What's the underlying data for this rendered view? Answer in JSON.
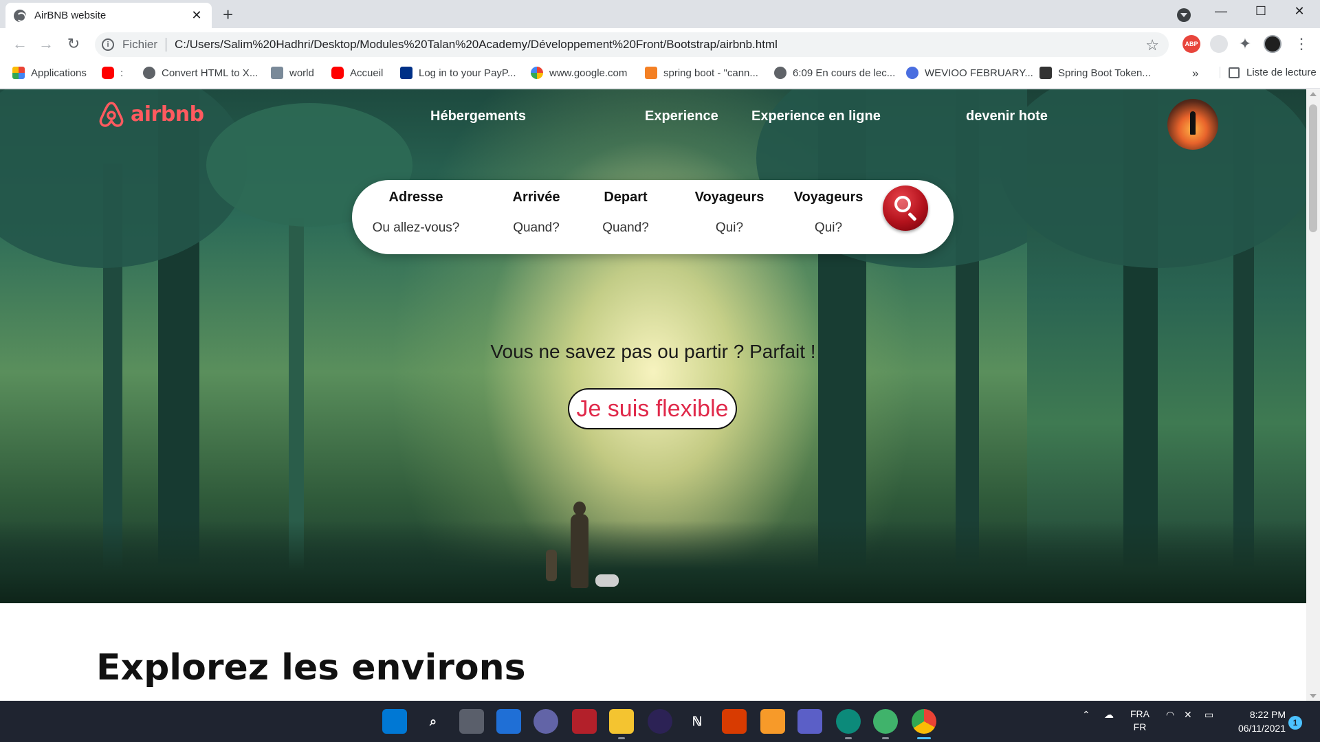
{
  "browser": {
    "tab_title": "AirBNB website",
    "tab_close": "✕",
    "new_tab": "+",
    "window_controls": [
      "—",
      "☐",
      "✕"
    ],
    "address": {
      "scheme_label": "Fichier",
      "url": "C:/Users/Salim%20Hadhri/Desktop/Modules%20Talan%20Academy/Développement%20Front/Bootstrap/airbnb.html"
    },
    "bookmarks": [
      {
        "label": "Applications",
        "icon": "apps-grid-icon",
        "color": "#ea4335"
      },
      {
        "label": ":",
        "icon": "youtube-icon",
        "color": "#ff0000"
      },
      {
        "label": "Convert HTML to X...",
        "icon": "globe-icon",
        "color": "#5f6368"
      },
      {
        "label": "world",
        "icon": "image-icon",
        "color": "#7a8a99"
      },
      {
        "label": "Accueil",
        "icon": "youtube-icon",
        "color": "#ff0000"
      },
      {
        "label": "Log in to your PayP...",
        "icon": "paypal-icon",
        "color": "#003087"
      },
      {
        "label": "www.google.com",
        "icon": "google-icon",
        "color": "#4285f4"
      },
      {
        "label": "spring boot - \"cann...",
        "icon": "stackoverflow-icon",
        "color": "#f48024"
      },
      {
        "label": "6:09 En cours de lec...",
        "icon": "globe-icon",
        "color": "#5f6368"
      },
      {
        "label": "WEVIOO FEBRUARY...",
        "icon": "globe-blue-icon",
        "color": "#4a6ee0"
      },
      {
        "label": "Spring Boot Token...",
        "icon": "zip-icon",
        "color": "#333333"
      }
    ],
    "bookmarks_more": "»",
    "reading_list": "Liste de lecture"
  },
  "page": {
    "logo_text": "airbnb",
    "nav": [
      "Hébergements",
      "Experience",
      "Experience en ligne",
      "devenir hote"
    ],
    "search": {
      "fields": [
        {
          "label": "Adresse",
          "placeholder": "Ou allez-vous?"
        },
        {
          "label": "Arrivée",
          "placeholder": "Quand?"
        },
        {
          "label": "Depart",
          "placeholder": "Quand?"
        },
        {
          "label": "Voyageurs",
          "placeholder": "Qui?"
        },
        {
          "label": "Voyageurs",
          "placeholder": "Qui?"
        }
      ]
    },
    "tagline": "Vous ne savez pas ou partir ? Parfait !",
    "flexible_button": "Je suis flexible",
    "section_title": "Explorez les environs",
    "colors": {
      "brand": "#ff5a5f",
      "flexible_text": "#e0294a"
    }
  },
  "taskbar": {
    "apps": [
      "windows-start-icon",
      "search-icon",
      "task-view-icon",
      "widgets-icon",
      "chat-icon",
      "game-icon",
      "file-explorer-icon",
      "eclipse-icon",
      "notion-icon",
      "office-icon",
      "sublime-icon",
      "teams-icon",
      "edge-icon",
      "atom-icon",
      "chrome-icon"
    ],
    "language": "FRA",
    "language_sub": "FR",
    "time": "8:22 PM",
    "date": "06/11/2021",
    "notifications": "1"
  }
}
